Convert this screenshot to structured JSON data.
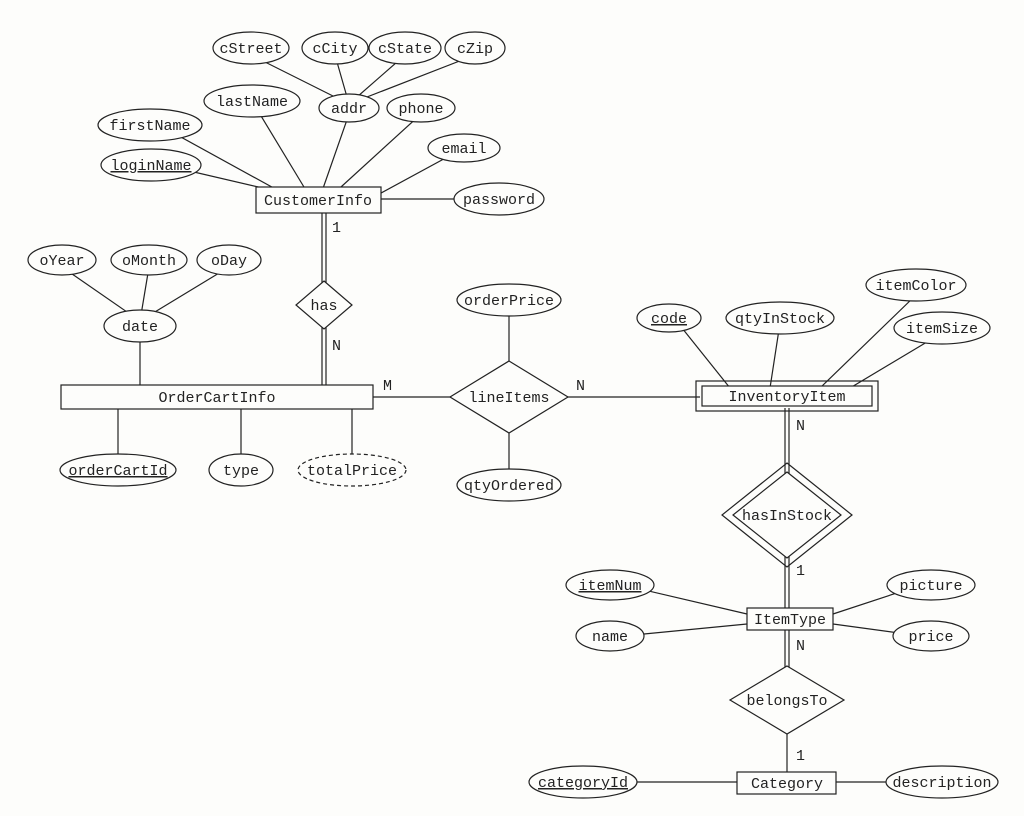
{
  "entities": {
    "customerInfo": "CustomerInfo",
    "orderCartInfo": "OrderCartInfo",
    "inventoryItem": "InventoryItem",
    "itemType": "ItemType",
    "category": "Category"
  },
  "relationships": {
    "has": "has",
    "lineItems": "lineItems",
    "hasInStock": "hasInStock",
    "belongsTo": "belongsTo"
  },
  "attributes": {
    "cStreet": "cStreet",
    "cCity": "cCity",
    "cState": "cState",
    "cZip": "cZip",
    "lastName": "lastName",
    "addr": "addr",
    "phone": "phone",
    "firstName": "firstName",
    "email": "email",
    "loginName": "loginName",
    "password": "password",
    "oYear": "oYear",
    "oMonth": "oMonth",
    "oDay": "oDay",
    "date": "date",
    "orderCartId": "orderCartId",
    "type": "type",
    "totalPrice": "totalPrice",
    "orderPrice": "orderPrice",
    "qtyOrdered": "qtyOrdered",
    "code": "code",
    "qtyInStock": "qtyInStock",
    "itemColor": "itemColor",
    "itemSize": "itemSize",
    "itemNum": "itemNum",
    "name": "name",
    "picture": "picture",
    "price": "price",
    "categoryId": "categoryId",
    "description": "description"
  },
  "cardinalities": {
    "c1": "1",
    "cN": "N",
    "cM": "M"
  }
}
